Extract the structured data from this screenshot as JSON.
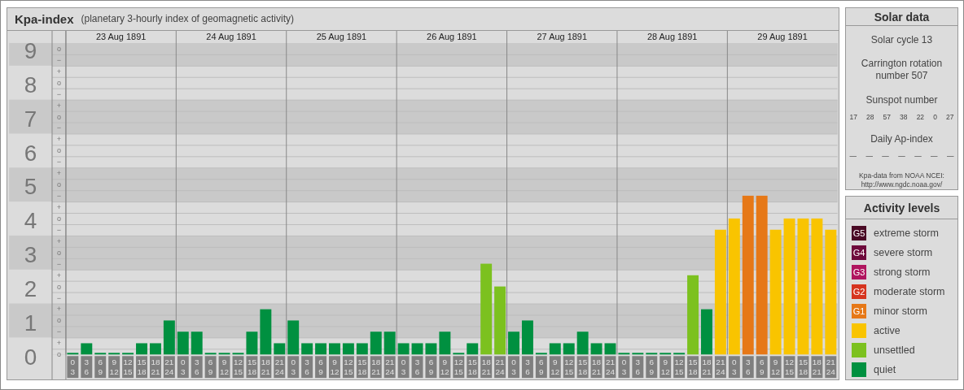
{
  "main_panel": {
    "title": "Kpa-index",
    "subtitle": "(planetary 3-hourly index of geomagnetic activity)",
    "days": [
      "23 Aug 1891",
      "24 Aug 1891",
      "25 Aug 1891",
      "26 Aug 1891",
      "27 Aug 1891",
      "28 Aug 1891",
      "29 Aug 1891"
    ],
    "sub_marks": [
      [
        "o",
        "−"
      ],
      [
        "+",
        "o",
        "−"
      ],
      [
        "+",
        "o",
        "−"
      ],
      [
        "+",
        "o",
        "−"
      ],
      [
        "+",
        "o",
        "−"
      ],
      [
        "+",
        "o",
        "−"
      ],
      [
        "+",
        "o",
        "−"
      ],
      [
        "+",
        "o",
        "−"
      ],
      [
        "+",
        "o",
        "−"
      ],
      [
        "+",
        "o"
      ]
    ],
    "chart_data": {
      "type": "bar",
      "ylim": [
        0,
        9.52
      ],
      "categories": [
        "0\n3",
        "3\n6",
        "6\n9",
        "9\n12",
        "12\n15",
        "15\n18",
        "18\n21",
        "21\n24",
        "0\n3",
        "3\n6",
        "6\n9",
        "9\n12",
        "12\n15",
        "15\n18",
        "18\n21",
        "21\n24",
        "0\n3",
        "3\n6",
        "6\n9",
        "9\n12",
        "12\n15",
        "15\n18",
        "18\n21",
        "21\n24",
        "0\n3",
        "3\n6",
        "6\n9",
        "9\n12",
        "12\n15",
        "15\n18",
        "18\n21",
        "21\n24",
        "0\n3",
        "3\n6",
        "6\n9",
        "9\n12",
        "12\n15",
        "15\n18",
        "18\n21",
        "21\n24",
        "0\n3",
        "3\n6",
        "6\n9",
        "9\n12",
        "12\n15",
        "15\n18",
        "18\n21",
        "21\n24",
        "0\n3",
        "3\n6",
        "6\n9",
        "9\n12",
        "12\n15",
        "15\n18",
        "18\n21",
        "21\n24"
      ],
      "yticks": [
        {
          "value": 9,
          "label": "9"
        },
        {
          "value": 8,
          "label": "8"
        },
        {
          "value": 7,
          "label": "7"
        },
        {
          "value": 6,
          "label": "6"
        },
        {
          "value": 5,
          "label": "5"
        },
        {
          "value": 4,
          "label": "4"
        },
        {
          "value": 3,
          "label": "3"
        },
        {
          "value": 2,
          "label": "2"
        },
        {
          "value": 1,
          "label": "1"
        },
        {
          "value": 0,
          "label": "0"
        }
      ],
      "series": [
        {
          "name": "quiet",
          "color": "#009040",
          "values": [
            0,
            0.33,
            0,
            0,
            0,
            0.33,
            0.33,
            1,
            0.67,
            0.67,
            0,
            0,
            0,
            0.67,
            1.33,
            0.33,
            1,
            0.33,
            0.33,
            0.33,
            0.33,
            0.33,
            0.67,
            0.67,
            0.33,
            0.33,
            0.33,
            0.67,
            0,
            0.33,
            null,
            null,
            0.67,
            1,
            0,
            0.33,
            0.33,
            0.67,
            0.33,
            0.33,
            0,
            0,
            0,
            0,
            0,
            null,
            1.33,
            null,
            null,
            null,
            null,
            null,
            null,
            null,
            null,
            null
          ]
        },
        {
          "name": "unsettled",
          "color": "#7cc11f",
          "values": [
            null,
            null,
            null,
            null,
            null,
            null,
            null,
            null,
            null,
            null,
            null,
            null,
            null,
            null,
            null,
            null,
            null,
            null,
            null,
            null,
            null,
            null,
            null,
            null,
            null,
            null,
            null,
            null,
            null,
            null,
            2.67,
            2,
            null,
            null,
            null,
            null,
            null,
            null,
            null,
            null,
            null,
            null,
            null,
            null,
            null,
            2.33,
            null,
            null,
            null,
            null,
            null,
            null,
            null,
            null,
            null,
            null
          ]
        },
        {
          "name": "active",
          "color": "#f9c400",
          "values": [
            null,
            null,
            null,
            null,
            null,
            null,
            null,
            null,
            null,
            null,
            null,
            null,
            null,
            null,
            null,
            null,
            null,
            null,
            null,
            null,
            null,
            null,
            null,
            null,
            null,
            null,
            null,
            null,
            null,
            null,
            null,
            null,
            null,
            null,
            null,
            null,
            null,
            null,
            null,
            null,
            null,
            null,
            null,
            null,
            null,
            null,
            null,
            3.67,
            4,
            null,
            null,
            3.67,
            4,
            4,
            4,
            3.67
          ]
        },
        {
          "name": "minor storm",
          "color": "#e67817",
          "values": [
            null,
            null,
            null,
            null,
            null,
            null,
            null,
            null,
            null,
            null,
            null,
            null,
            null,
            null,
            null,
            null,
            null,
            null,
            null,
            null,
            null,
            null,
            null,
            null,
            null,
            null,
            null,
            null,
            null,
            null,
            null,
            null,
            null,
            null,
            null,
            null,
            null,
            null,
            null,
            null,
            null,
            null,
            null,
            null,
            null,
            null,
            null,
            null,
            null,
            4.67,
            4.67,
            null,
            null,
            null,
            null,
            null
          ]
        }
      ]
    }
  },
  "solar_data": {
    "title": "Solar data",
    "cycle": "Solar cycle 13",
    "rotation": "Carrington rotation number 507",
    "sunspot_label": "Sunspot number",
    "sunspots": [
      "17",
      "28",
      "57",
      "38",
      "22",
      "0",
      "27"
    ],
    "ap_label": "Daily Ap-index",
    "ap_values": [
      "—",
      "—",
      "—",
      "—",
      "—",
      "—",
      "—"
    ],
    "source": "Kpa-data from NOAA NCEI: http://www.ngdc.noaa.gov/"
  },
  "activity_levels": {
    "title": "Activity levels",
    "items": [
      {
        "badge": "G5",
        "label": "extreme storm",
        "color": "#4a0a25"
      },
      {
        "badge": "G4",
        "label": "severe storm",
        "color": "#6e0a3c"
      },
      {
        "badge": "G3",
        "label": "strong storm",
        "color": "#b0155f"
      },
      {
        "badge": "G2",
        "label": "moderate storm",
        "color": "#d6341e"
      }
    ],
    "series_badges": [
      "G1"
    ]
  }
}
